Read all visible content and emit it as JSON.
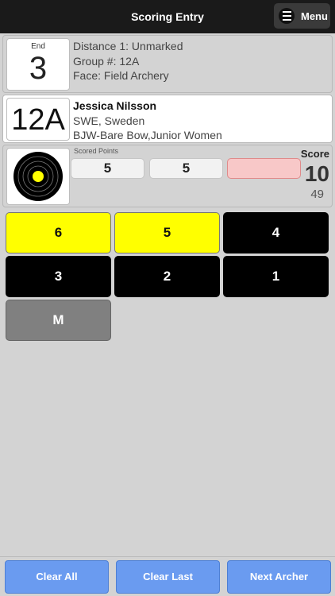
{
  "header": {
    "title": "Scoring Entry",
    "menu_label": "Menu"
  },
  "end": {
    "label": "End",
    "value": "3",
    "info": [
      "Distance 1: Unmarked",
      "Group #: 12A",
      "Face: Field Archery"
    ]
  },
  "archer": {
    "group": "12A",
    "name": "Jessica Nilsson",
    "country": "SWE, Sweden",
    "division": "BJW-Bare Bow,Junior Women"
  },
  "scoring": {
    "label": "Scored Points",
    "points": [
      "5",
      "5",
      ""
    ],
    "score_label": "Score",
    "end_total": "10",
    "running_total": "49"
  },
  "keypad": {
    "keys": [
      {
        "label": "6",
        "style": "yellow"
      },
      {
        "label": "5",
        "style": "yellow"
      },
      {
        "label": "4",
        "style": "black"
      },
      {
        "label": "3",
        "style": "black"
      },
      {
        "label": "2",
        "style": "black"
      },
      {
        "label": "1",
        "style": "black"
      },
      {
        "label": "M",
        "style": "gray"
      }
    ]
  },
  "footer": {
    "clear_all": "Clear All",
    "clear_last": "Clear Last",
    "next_archer": "Next Archer"
  },
  "colors": {
    "header_bg": "#1a1a1a",
    "accent_blue": "#6a9bf0",
    "yellow": "#ffff00",
    "active_cell": "#f8c8c8"
  }
}
